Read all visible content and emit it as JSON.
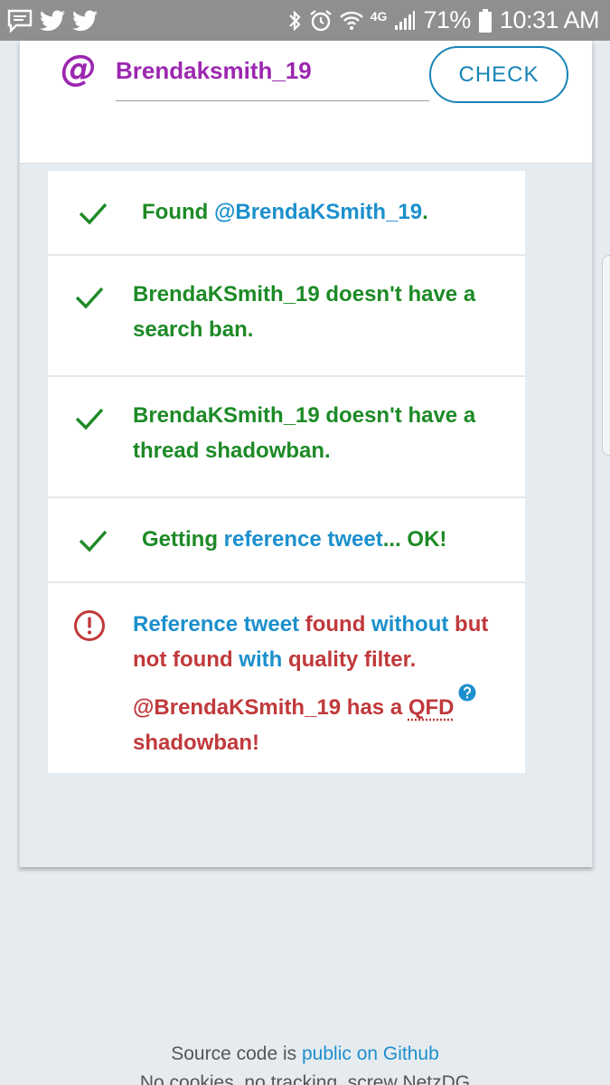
{
  "status_bar": {
    "battery": "71%",
    "time": "10:31 AM",
    "network": "4G",
    "icons_left": [
      "chat-icon",
      "twitter-icon",
      "twitter-icon"
    ],
    "icons_right": [
      "bluetooth-icon",
      "alarm-icon",
      "wifi-icon",
      "signal-icon",
      "battery-icon"
    ]
  },
  "form": {
    "at_symbol": "@",
    "username_value": "Brendaksmith_19",
    "check_label": "CHECK"
  },
  "results": {
    "found": {
      "prefix": "Found ",
      "handle": "@BrendaKSmith_19",
      "suffix": "."
    },
    "search_ban": {
      "line1": "BrendaKSmith_19 doesn't have a",
      "line2": "search ban."
    },
    "thread_ban": {
      "line1": "BrendaKSmith_19 doesn't have a",
      "line2": "thread shadowban."
    },
    "reference": {
      "prefix": "Getting ",
      "link": "reference tweet",
      "suffix": "... OK!"
    },
    "qfd": {
      "reference_tweet": "Reference tweet",
      "found": " found ",
      "without": "without",
      "but": " but",
      "not_found": "not found ",
      "with": "with",
      "quality_filter": " quality filter.",
      "handle_has_a": "@BrendaKSmith_19 has a ",
      "qfd_label": "QFD",
      "shadowban": "shadowban!"
    }
  },
  "footer": {
    "line1_prefix": "Source code is ",
    "line1_link": "public on Github",
    "line2": "No cookies, no tracking, screw NetzDG"
  },
  "colors": {
    "success": "#1d8a26",
    "link": "#1c90cc",
    "error": "#c0393b",
    "accent": "#9c27b0",
    "check_button": "#1784b5"
  }
}
